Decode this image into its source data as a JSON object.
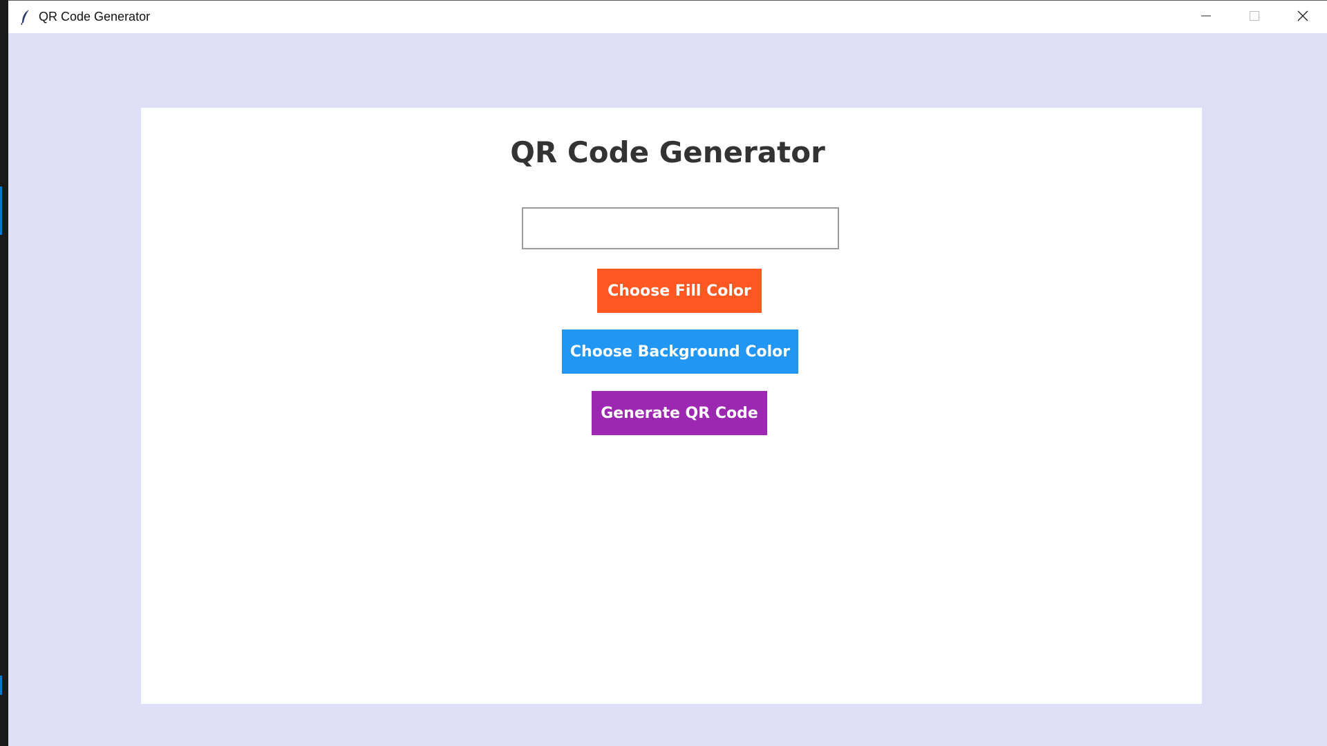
{
  "window": {
    "title": "QR Code Generator",
    "app_icon": "feather-icon",
    "controls": {
      "minimize_icon": "minimize-icon",
      "maximize_icon": "maximize-icon",
      "close_icon": "close-icon"
    }
  },
  "main": {
    "heading": "QR Code Generator",
    "input": {
      "value": "",
      "placeholder": ""
    },
    "buttons": {
      "fill_color": "Choose Fill Color",
      "background_color": "Choose Background Color",
      "generate": "Generate QR Code"
    }
  },
  "colors": {
    "window_background": "#dfdff7",
    "panel_background": "#ffffff",
    "heading_text": "#333333",
    "fill_button": "#ff5722",
    "background_button": "#2196f3",
    "generate_button": "#9c27b0"
  }
}
